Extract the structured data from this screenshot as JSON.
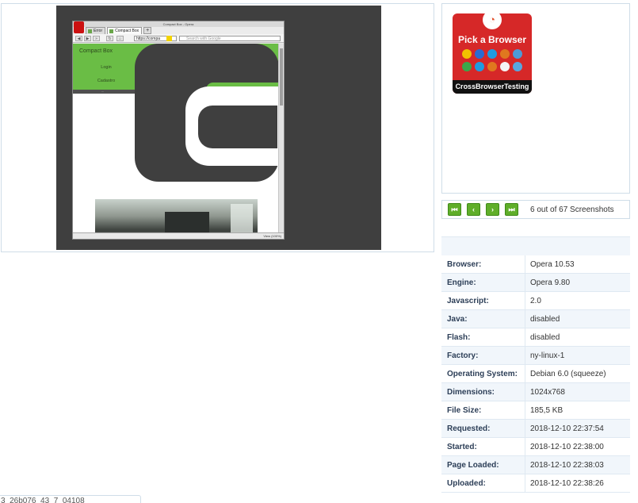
{
  "screenshot_browser": {
    "window_title": "Compact Box - Opera",
    "tabs": [
      {
        "label": "Error"
      },
      {
        "label": "Compact Box"
      }
    ],
    "address": "https://compa",
    "search_placeholder": "Search with Google",
    "zoom_label": "View (100%)",
    "page": {
      "site_name": "Compact Box",
      "menu": [
        "Login",
        "Cadastro"
      ],
      "separator_text": "---",
      "colors": {
        "green": "#6abd45",
        "dark": "#3f3f3f"
      }
    }
  },
  "promo": {
    "title": "Pick a Browser",
    "footer": "CrossBrowserTesting",
    "icon": "crossbrowsertesting-logo-icon",
    "browser_icons": [
      "chrome-icon",
      "firefox-icon",
      "ie-icon",
      "safari-icon",
      "opera-icon",
      "chrome-icon",
      "ie-icon",
      "firefox-icon",
      "opera-icon",
      "safari-icon"
    ]
  },
  "pager": {
    "first": "first-page-icon",
    "prev": "prev-page-icon",
    "next": "next-page-icon",
    "last": "last-page-icon",
    "status": "6 out of 67 Screenshots"
  },
  "details": [
    {
      "key": "Browser:",
      "value": "Opera 10.53"
    },
    {
      "key": "Engine:",
      "value": "Opera 9.80"
    },
    {
      "key": "Javascript:",
      "value": "2.0"
    },
    {
      "key": "Java:",
      "value": "disabled"
    },
    {
      "key": "Flash:",
      "value": "disabled"
    },
    {
      "key": "Factory:",
      "value": "ny-linux-1"
    },
    {
      "key": "Operating System:",
      "value": "Debian 6.0 (squeeze)"
    },
    {
      "key": "Dimensions:",
      "value": "1024x768"
    },
    {
      "key": "File Size:",
      "value": "185,5 KB"
    },
    {
      "key": "Requested:",
      "value": "2018-12-10 22:37:54"
    },
    {
      "key": "Started:",
      "value": "2018-12-10 22:38:00"
    },
    {
      "key": "Page Loaded:",
      "value": "2018-12-10 22:38:03"
    },
    {
      "key": "Uploaded:",
      "value": "2018-12-10 22:38:26"
    }
  ],
  "bottom_input": {
    "value": "3_26b076_43_7_04108"
  },
  "colors": {
    "accent_green": "#5fae2a",
    "table_label": "#2c3e57",
    "border": "#cfdde8"
  }
}
